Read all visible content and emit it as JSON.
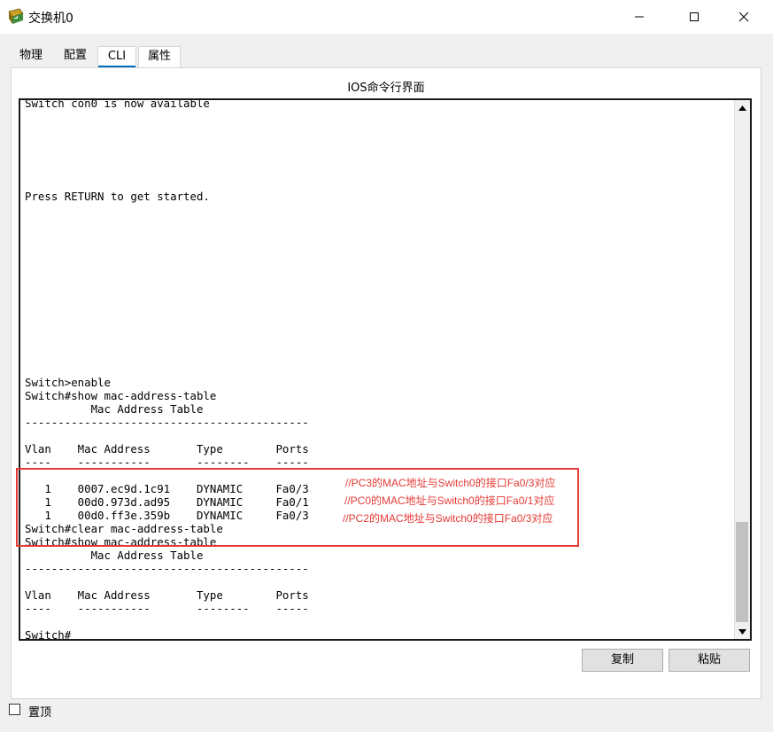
{
  "window": {
    "title": "交换机0",
    "tabs": [
      "物理",
      "配置",
      "CLI",
      "属性"
    ],
    "active_tab": "CLI"
  },
  "panel": {
    "title": "IOS命令行界面"
  },
  "terminal": {
    "lines": [
      "Switch con0 is now available",
      "",
      "",
      "",
      "",
      "",
      "",
      "Press RETURN to get started.",
      "",
      "",
      "",
      "",
      "",
      "",
      "",
      "",
      "",
      "",
      "",
      "",
      "",
      "Switch>enable",
      "Switch#show mac-address-table",
      "          Mac Address Table",
      "-------------------------------------------",
      "",
      "Vlan    Mac Address       Type        Ports",
      "----    -----------       --------    -----",
      "",
      "   1    0007.ec9d.1c91    DYNAMIC     Fa0/3",
      "   1    00d0.973d.ad95    DYNAMIC     Fa0/1",
      "   1    00d0.ff3e.359b    DYNAMIC     Fa0/3",
      "Switch#clear mac-address-table",
      "Switch#show mac-address-table",
      "          Mac Address Table",
      "-------------------------------------------",
      "",
      "Vlan    Mac Address       Type        Ports",
      "----    -----------       --------    -----",
      "",
      "Switch#"
    ]
  },
  "annotations": [
    "//PC3的MAC地址与Switch0的接口Fa0/3对应",
    "//PC0的MAC地址与Switch0的接口Fa0/1对应",
    "//PC2的MAC地址与Switch0的接口Fa0/3对应"
  ],
  "buttons": {
    "copy": "复制",
    "paste": "粘贴"
  },
  "always_on_top": {
    "label": "置顶",
    "checked": false
  },
  "colors": {
    "annotation": "#e53935",
    "active_tab_underline": "#0070c0"
  }
}
